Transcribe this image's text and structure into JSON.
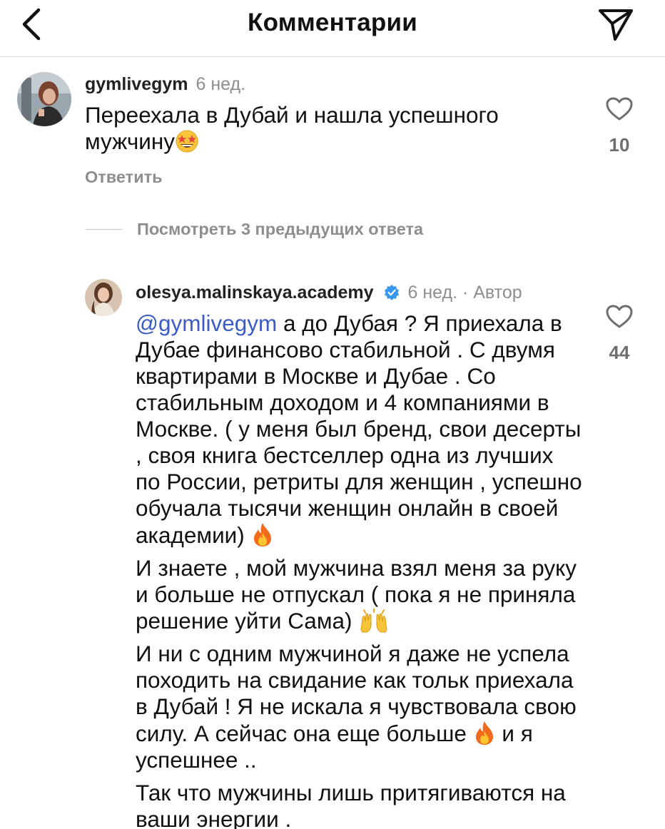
{
  "header": {
    "title": "Комментарии",
    "back_icon": "chevron-left-icon",
    "send_icon": "paper-plane-icon"
  },
  "comments": [
    {
      "username": "gymlivegym",
      "time": "6 нед.",
      "text": "Переехала в Дубай и нашла успешного мужчину",
      "emoji": "star-struck-emoji",
      "likes": "10",
      "reply_label": "Ответить"
    }
  ],
  "view_replies": {
    "label": "Посмотреть 3 предыдущих ответа"
  },
  "reply": {
    "username": "olesya.malinskaya.academy",
    "verified_icon": "verified-badge-icon",
    "time": "6 нед.",
    "separator": "·",
    "author_label": "Автор",
    "mention": "@gymlivegym",
    "paragraph1": " а до Дубая ? Я приехала в Дубае финансово стабильной . С двумя квартирами в Москве и Дубае . Со стабильным доходом и 4 компаниями в Москве. ( у меня был бренд, свои десерты , своя книга бестселлер одна из лучших по России, ретриты для женщин , успешно обучала тысячи женщин онлайн в своей академии)",
    "paragraph2": "И знаете , мой мужчина взял меня за руку и больше не отпускал ( пока я не приняла решение уйти  Сама)",
    "paragraph3a": "И ни с одним мужчиной я даже не успела походить на свидание как тольк приехала в Дубай ! Я не искала я чувствовала свою силу. А сейчас она еще больше",
    "paragraph3b": " и я успешнее ..",
    "paragraph4": "Так что мужчины лишь притягиваются на ваши энергии .",
    "likes": "44"
  },
  "colors": {
    "mention": "#3b5bc5",
    "muted": "#8e8e8e",
    "verified": "#3897f0",
    "divider": "#dbdbdb"
  }
}
